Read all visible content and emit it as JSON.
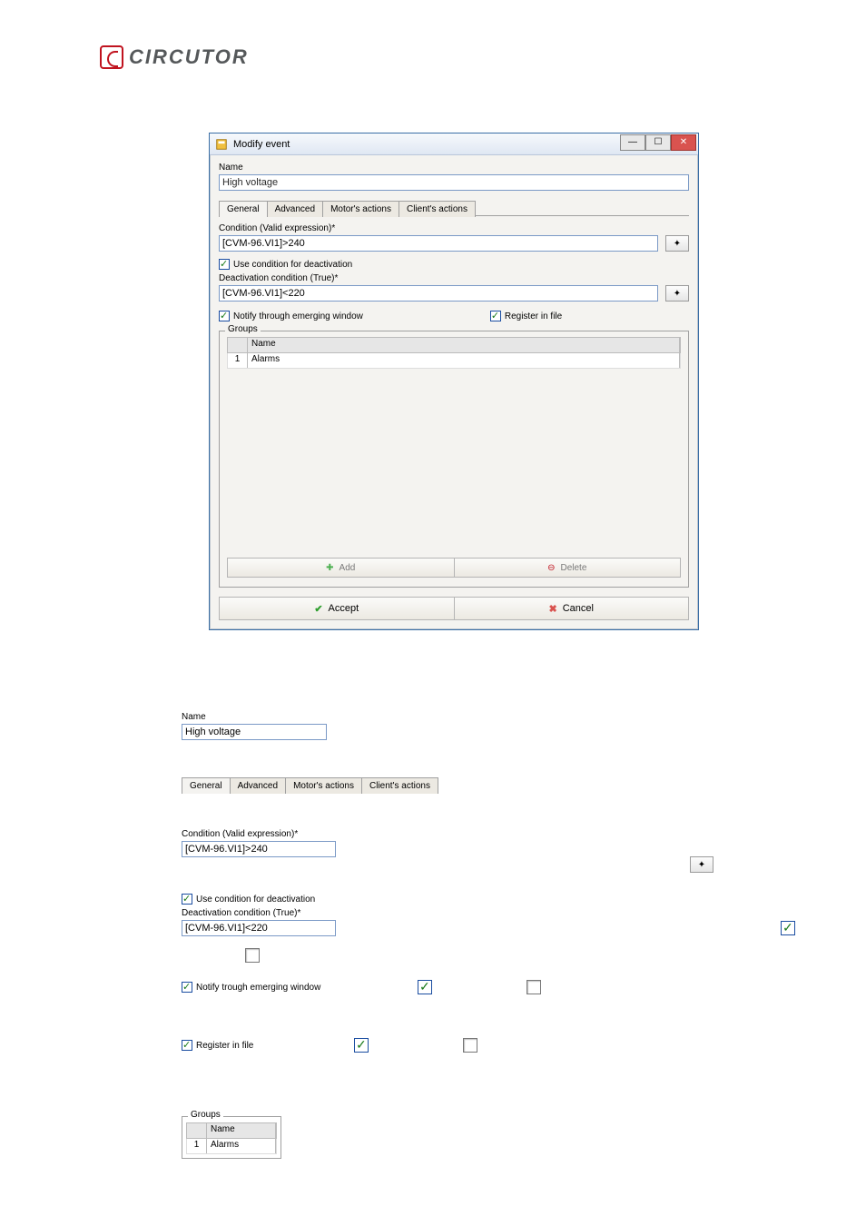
{
  "brand": {
    "name": "CIRCUTOR"
  },
  "dialog": {
    "title": "Modify event",
    "name_label": "Name",
    "name_value": "High voltage",
    "tabs": {
      "general": "General",
      "advanced": "Advanced",
      "motors": "Motor's actions",
      "clients": "Client's actions"
    },
    "condition_label": "Condition (Valid expression)*",
    "condition_value": "[CVM-96.VI1]>240",
    "use_deact_label": "Use condition for deactivation",
    "deact_label": "Deactivation condition (True)*",
    "deact_value": "[CVM-96.VI1]<220",
    "notify_label": "Notify through emerging window",
    "register_label": "Register in file",
    "groups_legend": "Groups",
    "groups_col_name": "Name",
    "groups_row1_n": "1",
    "groups_row1_name": "Alarms",
    "add_label": "Add",
    "delete_label": "Delete",
    "accept_label": "Accept",
    "cancel_label": "Cancel"
  },
  "closeups": {
    "name_label": "Name",
    "name_value": "High voltage",
    "condition_label": "Condition (Valid expression)*",
    "condition_value": "[CVM-96.VI1]>240",
    "use_deact_label": "Use condition for deactivation",
    "deact_label": "Deactivation condition (True)*",
    "deact_value": "[CVM-96.VI1]<220",
    "notify_label": "Notify trough emerging window",
    "register_label": "Register in file",
    "groups_legend": "Groups",
    "groups_col_name": "Name",
    "groups_row1_n": "1",
    "groups_row1_name": "Alarms"
  }
}
